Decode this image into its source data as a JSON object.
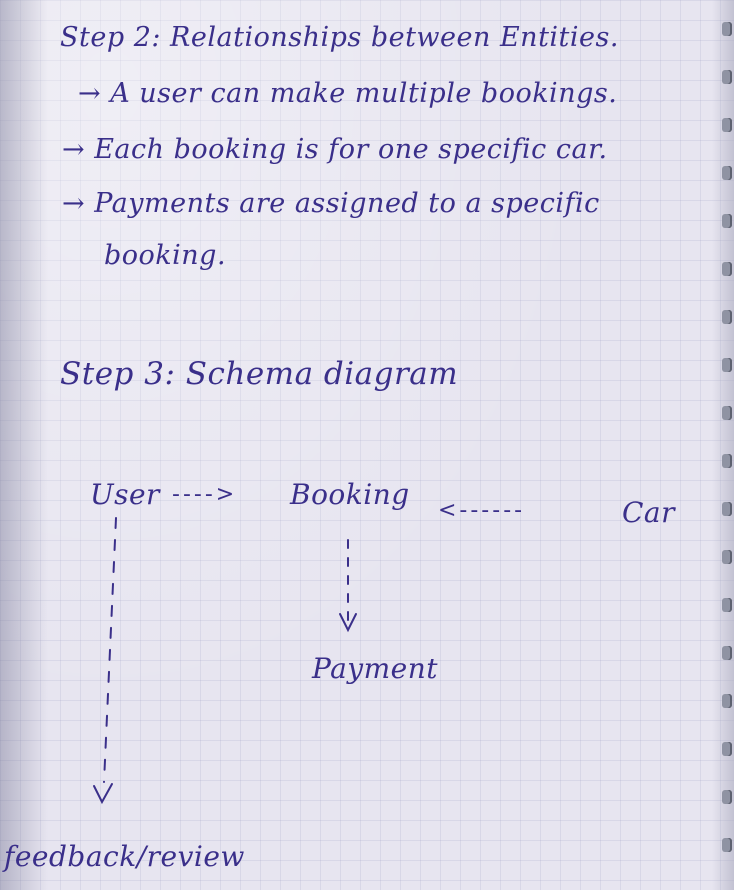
{
  "notes": {
    "step2_heading": "Step 2: Relationships between Entities.",
    "bullet_1": "→ A user can make multiple bookings.",
    "bullet_2": "→ Each booking is for one specific car.",
    "bullet_3_line1": "→ Payments are assigned to a specific",
    "bullet_3_line2": "booking.",
    "step3_heading": "Step 3: Schema diagram"
  },
  "diagram": {
    "user": "User",
    "booking": "Booking",
    "car": "Car",
    "payment": "Payment",
    "feedback": "feedback/review",
    "arrow_user_booking": "---->",
    "arrow_car_booking": "<------"
  }
}
